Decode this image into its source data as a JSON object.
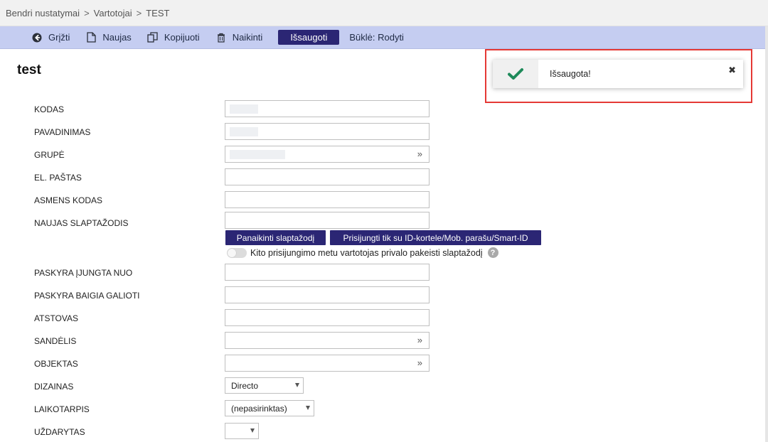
{
  "breadcrumb": [
    "Bendri nustatymai",
    "Vartotojai",
    "TEST"
  ],
  "breadcrumb_sep": ">",
  "toolbar": {
    "back": "Grįžti",
    "new": "Naujas",
    "copy": "Kopijuoti",
    "delete": "Naikinti",
    "save": "Išsaugoti",
    "state": "Būklė: Rodyti"
  },
  "page_title": "test",
  "fields": {
    "kodas": "KODAS",
    "pavadinimas": "PAVADINIMAS",
    "grupe": "GRUPĖ",
    "el_pastas": "EL. PAŠTAS",
    "asmens_kodas": "ASMENS KODAS",
    "naujas_slaptazodis": "NAUJAS SLAPTAŽODIS",
    "paskyra_ijungta": "PASKYRA ĮJUNGTA NUO",
    "paskyra_baigia": "PASKYRA BAIGIA GALIOTI",
    "atstovas": "ATSTOVAS",
    "sandelis": "SANDĖLIS",
    "objektas": "OBJEKTAS",
    "dizainas": "DIZAINAS",
    "laikotarpis": "LAIKOTARPIS",
    "uzdarytas": "UŽDARYTAS"
  },
  "buttons": {
    "remove_password": "Panaikinti slaptažodį",
    "id_login": "Prisijungti tik su ID-kortele/Mob. parašu/Smart-ID"
  },
  "toggle_label": "Kito prisijungimo metu vartotojas privalo pakeisti slaptažodį",
  "help_glyph": "?",
  "selects": {
    "dizainas": "Directo",
    "laikotarpis": "(nepasirinktas)",
    "uzdarytas": ""
  },
  "picker_glyph": "»",
  "toast": {
    "message": "Išsaugota!",
    "close": "✖",
    "accent_color": "#1e8a5a"
  },
  "colors": {
    "toolbar_bg": "#c5cdf1",
    "primary_button": "#2b2674",
    "highlight_frame": "#e53935"
  }
}
